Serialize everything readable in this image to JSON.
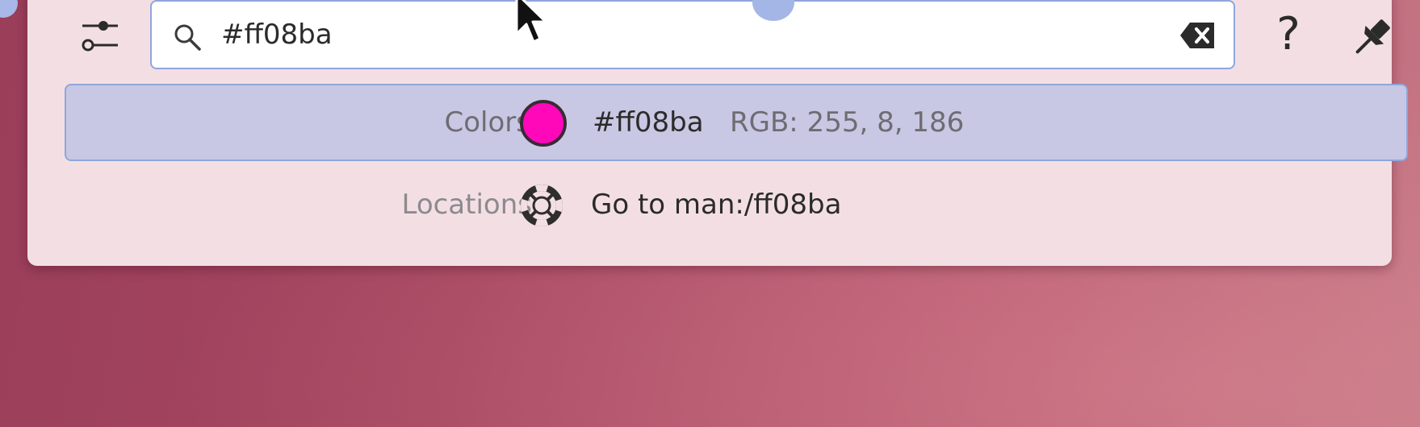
{
  "search": {
    "query": "#ff08ba"
  },
  "toolbar": {
    "config_icon": "configure-sliders-icon",
    "clear_icon": "clear-text-icon",
    "help_label": "?",
    "pin_icon": "pin-icon"
  },
  "results": [
    {
      "category": "Colors",
      "title": "#ff08ba",
      "subtitle": "RGB: 255, 8, 186",
      "swatch_color": "#ff08ba",
      "selected": true
    },
    {
      "category": "Locations",
      "title": "Go to man:/ff08ba",
      "icon": "help-lifebuoy-icon",
      "selected": false
    }
  ],
  "theme": {
    "panel_bg": "#f3dfe3",
    "accent": "#8ea6dc",
    "selection_bg": "#c8c8e4"
  }
}
